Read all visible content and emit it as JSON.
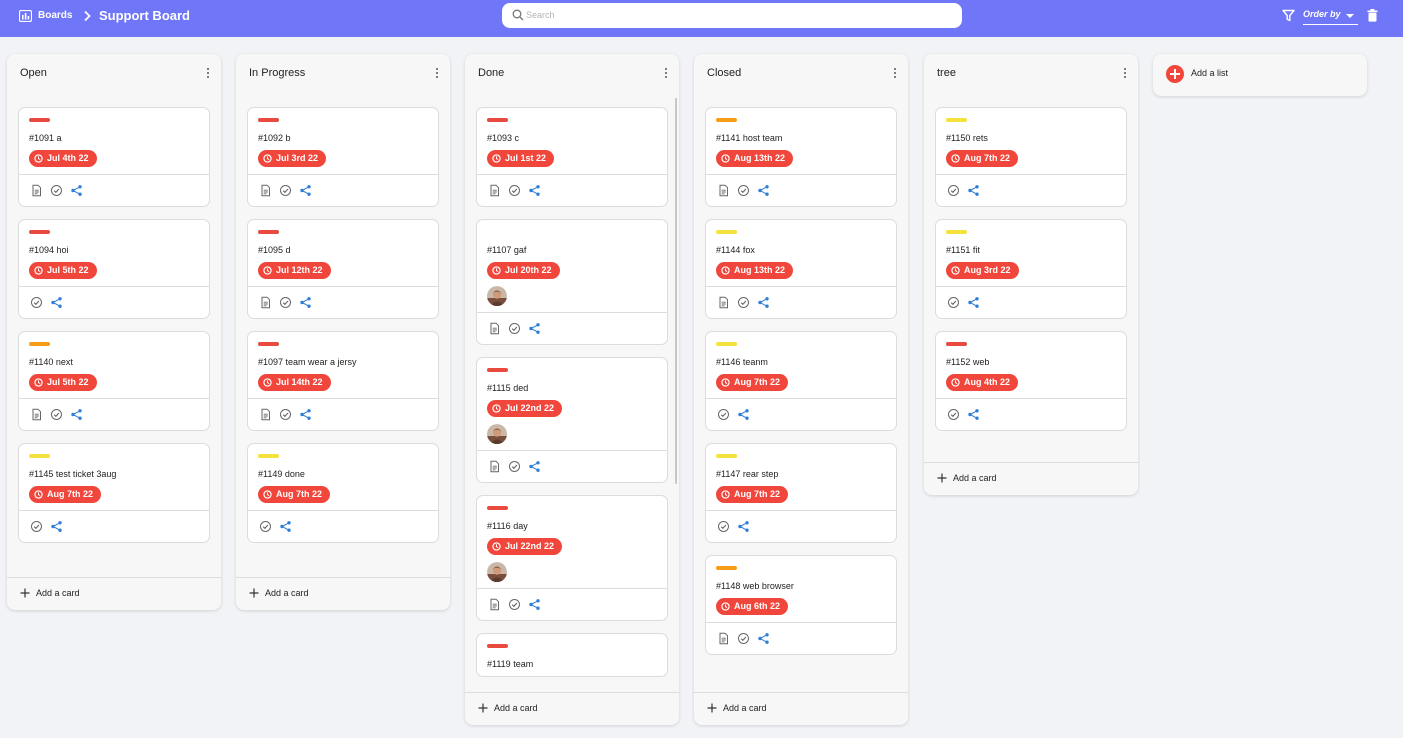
{
  "header": {
    "boards_label": "Boards",
    "board_title": "Support Board",
    "search_placeholder": "Search",
    "order_by_label": "Order by"
  },
  "colors": {
    "topbar": "#7076f8",
    "badge": "#f0463c",
    "priority_red": "#e84a3d",
    "priority_orange": "#f59d14",
    "priority_yellow": "#f4e23a"
  },
  "add_card_label": "Add a card",
  "add_list_label": "Add a list",
  "lists": [
    {
      "title": "Open",
      "cards": [
        {
          "priority": "red",
          "title": "#1091 a",
          "date": "Jul 4th 22",
          "icons": [
            "doc",
            "check",
            "share"
          ]
        },
        {
          "priority": "red",
          "title": "#1094 hoi",
          "date": "Jul 5th 22",
          "icons": [
            "check",
            "share"
          ]
        },
        {
          "priority": "orange",
          "title": "#1140 next",
          "date": "Jul 5th 22",
          "icons": [
            "doc",
            "check",
            "share"
          ]
        },
        {
          "priority": "yellow",
          "title": "#1145 test ticket 3aug",
          "date": "Aug 7th 22",
          "icons": [
            "check",
            "share"
          ]
        }
      ]
    },
    {
      "title": "In Progress",
      "cards": [
        {
          "priority": "red",
          "title": "#1092 b",
          "date": "Jul 3rd 22",
          "icons": [
            "doc",
            "check",
            "share"
          ]
        },
        {
          "priority": "red",
          "title": "#1095 d",
          "date": "Jul 12th 22",
          "icons": [
            "doc",
            "check",
            "share"
          ]
        },
        {
          "priority": "red",
          "title": "#1097 team wear a jersy",
          "date": "Jul 14th 22",
          "icons": [
            "doc",
            "check",
            "share"
          ]
        },
        {
          "priority": "yellow",
          "title": "#1149 done",
          "date": "Aug 7th 22",
          "icons": [
            "check",
            "share"
          ]
        }
      ]
    },
    {
      "title": "Done",
      "scroll": true,
      "cards": [
        {
          "priority": "red",
          "title": "#1093 c",
          "date": "Jul 1st 22",
          "icons": [
            "doc",
            "check",
            "share"
          ]
        },
        {
          "priority": "none",
          "title": "#1107 gaf",
          "date": "Jul 20th 22",
          "avatar": true,
          "icons": [
            "doc",
            "check",
            "share"
          ]
        },
        {
          "priority": "red",
          "title": "#1115 ded",
          "date": "Jul 22nd 22",
          "avatar": true,
          "icons": [
            "doc",
            "check",
            "share"
          ]
        },
        {
          "priority": "red",
          "title": "#1116 day",
          "date": "Jul 22nd 22",
          "avatar": true,
          "icons": [
            "doc",
            "check",
            "share"
          ]
        },
        {
          "priority": "red",
          "title": "#1119 team",
          "date": "",
          "icons": []
        }
      ]
    },
    {
      "title": "Closed",
      "cards": [
        {
          "priority": "orange",
          "title": "#1141 host team",
          "date": "Aug 13th 22",
          "icons": [
            "doc",
            "check",
            "share"
          ]
        },
        {
          "priority": "yellow",
          "title": "#1144 fox",
          "date": "Aug 13th 22",
          "icons": [
            "doc",
            "check",
            "share"
          ]
        },
        {
          "priority": "yellow",
          "title": "#1146 teanm",
          "date": "Aug 7th 22",
          "icons": [
            "check",
            "share"
          ]
        },
        {
          "priority": "yellow",
          "title": "#1147 rear step",
          "date": "Aug 7th 22",
          "icons": [
            "check",
            "share"
          ]
        },
        {
          "priority": "orange",
          "title": "#1148 web browser",
          "date": "Aug 6th 22",
          "icons": [
            "doc",
            "check",
            "share"
          ]
        }
      ]
    },
    {
      "title": "tree",
      "cards": [
        {
          "priority": "yellow",
          "title": "#1150 rets",
          "date": "Aug 7th 22",
          "icons": [
            "check",
            "share"
          ]
        },
        {
          "priority": "yellow",
          "title": "#1151 fit",
          "date": "Aug 3rd 22",
          "icons": [
            "check",
            "share"
          ]
        },
        {
          "priority": "red",
          "title": "#1152 web",
          "date": "Aug 4th 22",
          "icons": [
            "check",
            "share"
          ]
        }
      ]
    }
  ]
}
